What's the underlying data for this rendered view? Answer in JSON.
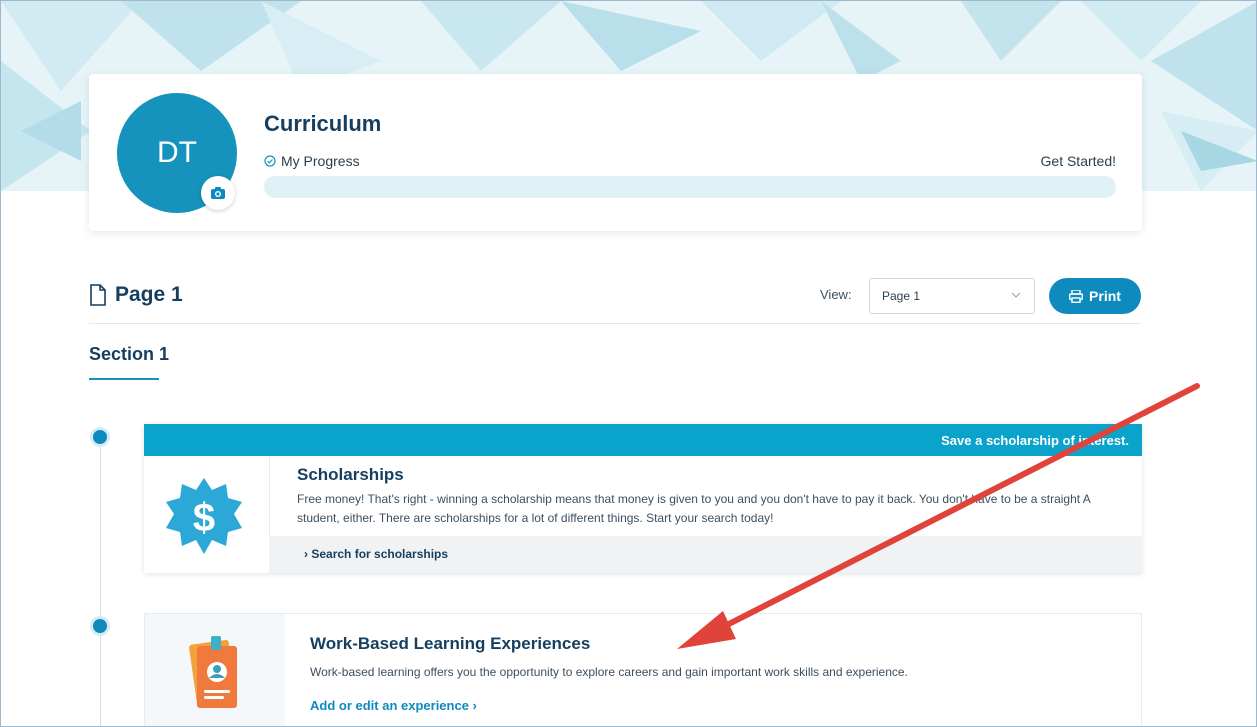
{
  "profile": {
    "initials": "DT",
    "curriculum_title": "Curriculum",
    "progress_label": "My Progress",
    "progress_status": "Get Started!",
    "progress_fraction": 0
  },
  "page": {
    "title": "Page 1",
    "view_label": "View:",
    "view_selected": "Page 1",
    "print_label": "Print"
  },
  "section": {
    "title": "Section 1"
  },
  "scholarships": {
    "banner": "Save a scholarship of interest.",
    "title": "Scholarships",
    "description": "Free money! That's right - winning a scholarship means that money is given to you and you don't have to pay it back. You don't have to be a straight A student, either. There are scholarships for a lot of different things. Start your search today!",
    "link": "Search for scholarships"
  },
  "work_based": {
    "title": "Work-Based Learning Experiences",
    "description": "Work-based learning offers you the opportunity to explore careers and gain important work skills and experience.",
    "link": "Add or edit an experience"
  },
  "colors": {
    "primary": "#0f8abf",
    "banner": "#0aa3cc",
    "arrow": "#e0433a"
  }
}
